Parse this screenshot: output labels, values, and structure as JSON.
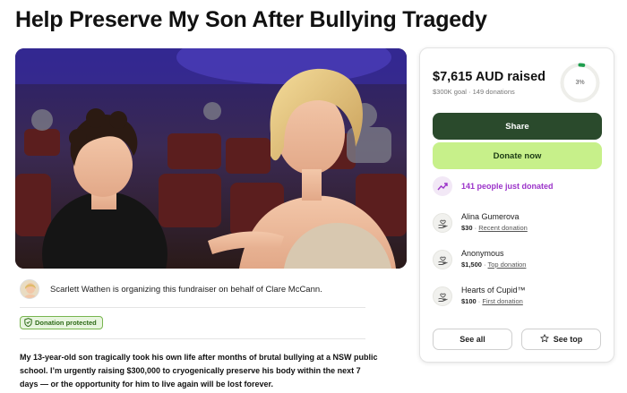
{
  "page": {
    "title": "Help Preserve My Son After Bullying Tragedy"
  },
  "organizer": {
    "text": "Scarlett Wathen is organizing this fundraiser on behalf of Clare McCann."
  },
  "badge": {
    "label": "Donation protected"
  },
  "description": {
    "text": "My 13-year-old son tragically took his own life after months of brutal bullying at a NSW public school. I’m urgently raising $300,000 to cryogenically preserve his body within the next 7 days — or the opportunity for him to live again will be lost forever."
  },
  "donation_card": {
    "raised": "$7,615 AUD raised",
    "goal": "$300K goal",
    "separator": "·",
    "donations_count": "149 donations",
    "progress_label": "3%",
    "progress_fraction": 0.03,
    "share_label": "Share",
    "donate_label": "Donate now",
    "recent_activity": "141 people just donated",
    "donors": [
      {
        "name": "Alina Gumerova",
        "amount": "$30",
        "sep": "·",
        "tag": "Recent donation"
      },
      {
        "name": "Anonymous",
        "amount": "$1,500",
        "sep": "·",
        "tag": "Top donation"
      },
      {
        "name": "Hearts of Cupid™",
        "amount": "$100",
        "sep": "·",
        "tag": "First donation"
      }
    ],
    "see_all_label": "See all",
    "see_top_label": "See top"
  },
  "colors": {
    "share_button": "#2a4a2c",
    "donate_button": "#c7f08a",
    "progress_ring": "#1f9e4e",
    "recent_activity": "#9b33c9",
    "badge_border": "#78b54f"
  },
  "icons": {
    "shield": "shield-check-icon",
    "trend": "trending-up-icon",
    "donor": "heart-hand-icon",
    "star": "star-outline-icon"
  }
}
